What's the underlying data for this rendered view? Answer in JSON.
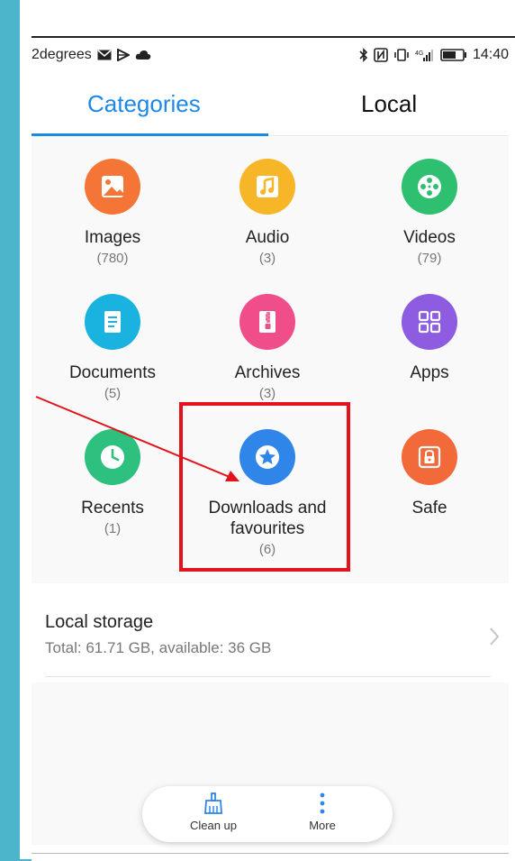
{
  "status_bar": {
    "carrier": "2degrees",
    "time": "14:40"
  },
  "tabs": [
    {
      "label": "Categories",
      "active": true
    },
    {
      "label": "Local",
      "active": false
    }
  ],
  "categories": [
    {
      "label": "Images",
      "count": "(780)",
      "icon": "image-icon",
      "color": "#f47535"
    },
    {
      "label": "Audio",
      "count": "(3)",
      "icon": "music-note-icon",
      "color": "#f7b627"
    },
    {
      "label": "Videos",
      "count": "(79)",
      "icon": "film-reel-icon",
      "color": "#2fbf71"
    },
    {
      "label": "Documents",
      "count": "(5)",
      "icon": "document-icon",
      "color": "#1ab3e0"
    },
    {
      "label": "Archives",
      "count": "(3)",
      "icon": "archive-zip-icon",
      "color": "#ef4e8b"
    },
    {
      "label": "Apps",
      "count": "",
      "icon": "apps-grid-icon",
      "color": "#8d5ce0"
    },
    {
      "label": "Recents",
      "count": "(1)",
      "icon": "clock-icon",
      "color": "#2ec07f"
    },
    {
      "label": "Downloads and favourites",
      "count": "(6)",
      "icon": "star-icon",
      "color": "#2f86e8"
    },
    {
      "label": "Safe",
      "count": "",
      "icon": "safe-lock-icon",
      "color": "#f26a3a"
    }
  ],
  "storage": {
    "title": "Local storage",
    "subtitle": "Total: 61.71 GB, available: 36 GB"
  },
  "bottom_bar": {
    "clean_up": "Clean up",
    "more": "More"
  },
  "colors": {
    "accent": "#1e88e5",
    "highlight": "#e3121b",
    "frame": "#4cb4cb"
  }
}
